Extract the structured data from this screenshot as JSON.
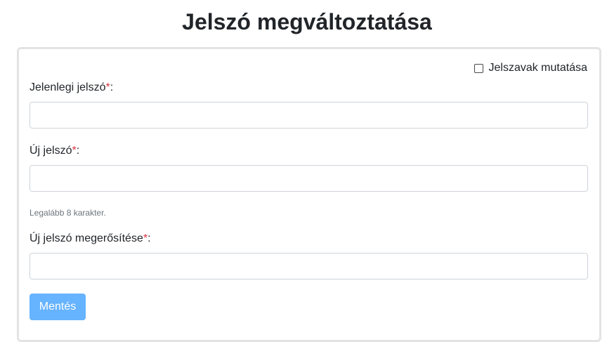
{
  "page": {
    "title": "Jelszó megváltoztatása"
  },
  "form": {
    "show_passwords_label": "Jelszavak mutatása",
    "current_password": {
      "label": "Jelenlegi jelszó",
      "required_mark": "*",
      "suffix": ":",
      "value": ""
    },
    "new_password": {
      "label": "Új jelszó",
      "required_mark": "*",
      "suffix": ":",
      "value": "",
      "help": "Legalább 8 karakter."
    },
    "confirm_password": {
      "label": "Új jelszó megerősítése",
      "required_mark": "*",
      "suffix": ":",
      "value": ""
    },
    "save_label": "Mentés"
  },
  "colors": {
    "required": "#dc3545",
    "button_bg": "#66b3ff",
    "help_text": "#6c757d"
  }
}
